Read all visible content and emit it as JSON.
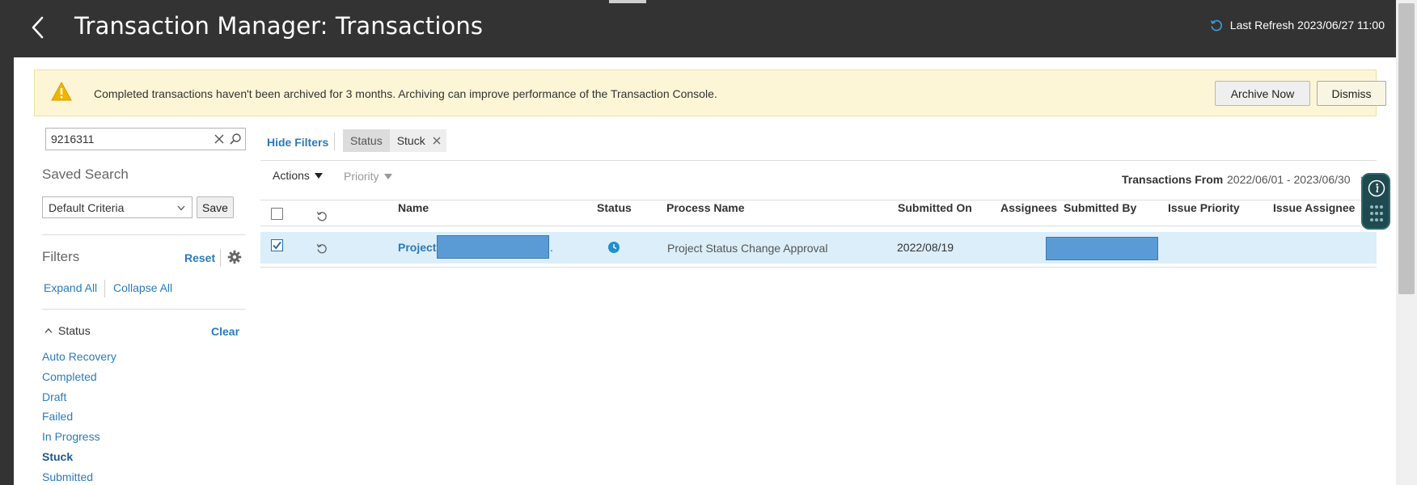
{
  "header": {
    "title": "Transaction Manager: Transactions",
    "last_refresh": "Last Refresh 2023/06/27 11:00"
  },
  "banner": {
    "message": "Completed transactions haven't been archived for 3 months. Archiving can improve performance of the Transaction Console.",
    "archive_label": "Archive Now",
    "dismiss_label": "Dismiss"
  },
  "search": {
    "value": "9216311"
  },
  "saved_search": {
    "label": "Saved Search",
    "selected": "Default Criteria",
    "save_label": "Save"
  },
  "filters": {
    "label": "Filters",
    "reset_label": "Reset",
    "expand_all": "Expand All",
    "collapse_all": "Collapse All",
    "status_heading": "Status",
    "clear_label": "Clear",
    "status_items": [
      "Auto Recovery",
      "Completed",
      "Draft",
      "Failed",
      "In Progress",
      "Stuck",
      "Submitted"
    ],
    "selected_status": "Stuck"
  },
  "toolbar": {
    "hide_filters": "Hide Filters",
    "chip_name": "Status",
    "chip_value": "Stuck",
    "actions": "Actions",
    "priority": "Priority",
    "tx_from_label": "Transactions From",
    "tx_from_value": "2022/06/01 - 2023/06/30"
  },
  "table": {
    "columns": {
      "name": "Name",
      "status": "Status",
      "process_name": "Process Name",
      "submitted_on": "Submitted On",
      "assignees": "Assignees",
      "submitted_by": "Submitted By",
      "issue_priority": "Issue Priority",
      "issue_assignee": "Issue Assignee"
    },
    "rows": [
      {
        "name": "Project",
        "name_suffix": ".",
        "process_name": "Project Status Change Approval",
        "submitted_on": "2022/08/19",
        "checked": true
      }
    ]
  },
  "colors": {
    "header_bg": "#333333",
    "link": "#2a7bbd",
    "banner_bg": "#fcf6d6",
    "selected_row": "#dbeef9",
    "redaction": "#5a9bd5"
  }
}
